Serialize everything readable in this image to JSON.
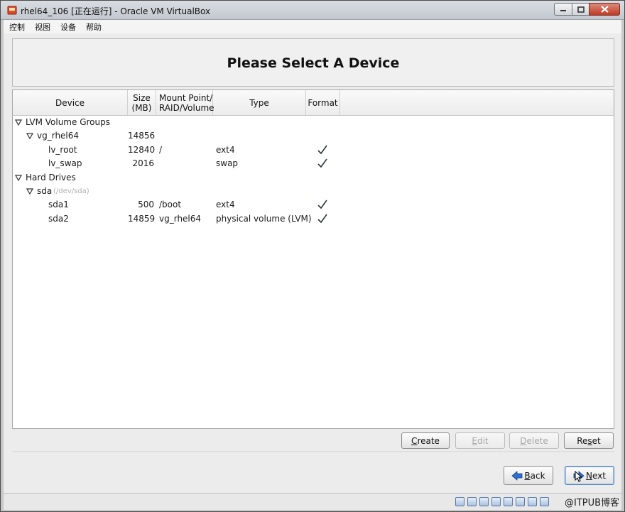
{
  "window": {
    "title": "rhel64_106 [正在运行] - Oracle VM VirtualBox"
  },
  "menubar": {
    "items": [
      "控制",
      "视图",
      "设备",
      "帮助"
    ]
  },
  "header": {
    "title": "Please Select A Device"
  },
  "table": {
    "columns": {
      "device": "Device",
      "size_line1": "Size",
      "size_line2": "(MB)",
      "mount_line1": "Mount Point/",
      "mount_line2": "RAID/Volume",
      "type": "Type",
      "format": "Format"
    },
    "rows": [
      {
        "name": "LVM Volume Groups",
        "size": "",
        "mount": "",
        "type": "",
        "format": false,
        "expander": true,
        "subtitle": ""
      },
      {
        "name": "vg_rhel64",
        "size": "14856",
        "mount": "",
        "type": "",
        "format": false,
        "expander": true,
        "subtitle": ""
      },
      {
        "name": "lv_root",
        "size": "12840",
        "mount": "/",
        "type": "ext4",
        "format": true,
        "expander": false,
        "subtitle": ""
      },
      {
        "name": "lv_swap",
        "size": "2016",
        "mount": "",
        "type": "swap",
        "format": true,
        "expander": false,
        "subtitle": ""
      },
      {
        "name": "Hard Drives",
        "size": "",
        "mount": "",
        "type": "",
        "format": false,
        "expander": true,
        "subtitle": ""
      },
      {
        "name": "sda",
        "size": "",
        "mount": "",
        "type": "",
        "format": false,
        "expander": true,
        "subtitle": "(/dev/sda)"
      },
      {
        "name": "sda1",
        "size": "500",
        "mount": "/boot",
        "type": "ext4",
        "format": true,
        "expander": false,
        "subtitle": ""
      },
      {
        "name": "sda2",
        "size": "14859",
        "mount": "vg_rhel64",
        "type": "physical volume (LVM)",
        "format": true,
        "expander": false,
        "subtitle": ""
      }
    ]
  },
  "actions": {
    "create_first": "C",
    "create_rest": "reate",
    "edit_first": "E",
    "edit_rest": "dit",
    "delete_first": "D",
    "delete_rest": "elete",
    "reset_pre": "Re",
    "reset_u": "s",
    "reset_post": "et"
  },
  "navigation": {
    "back_first": "B",
    "back_rest": "ack",
    "next_first": "N",
    "next_rest": "ext"
  },
  "statusbar": {
    "watermark": "@ITPUB博客"
  },
  "colors": {
    "header_bg": "#f0f0f0",
    "tree_bg": "#ffffff",
    "accent": "#4a7fbf",
    "close_button": "#c13b22",
    "subtitle_text": "#b0b0b0"
  }
}
